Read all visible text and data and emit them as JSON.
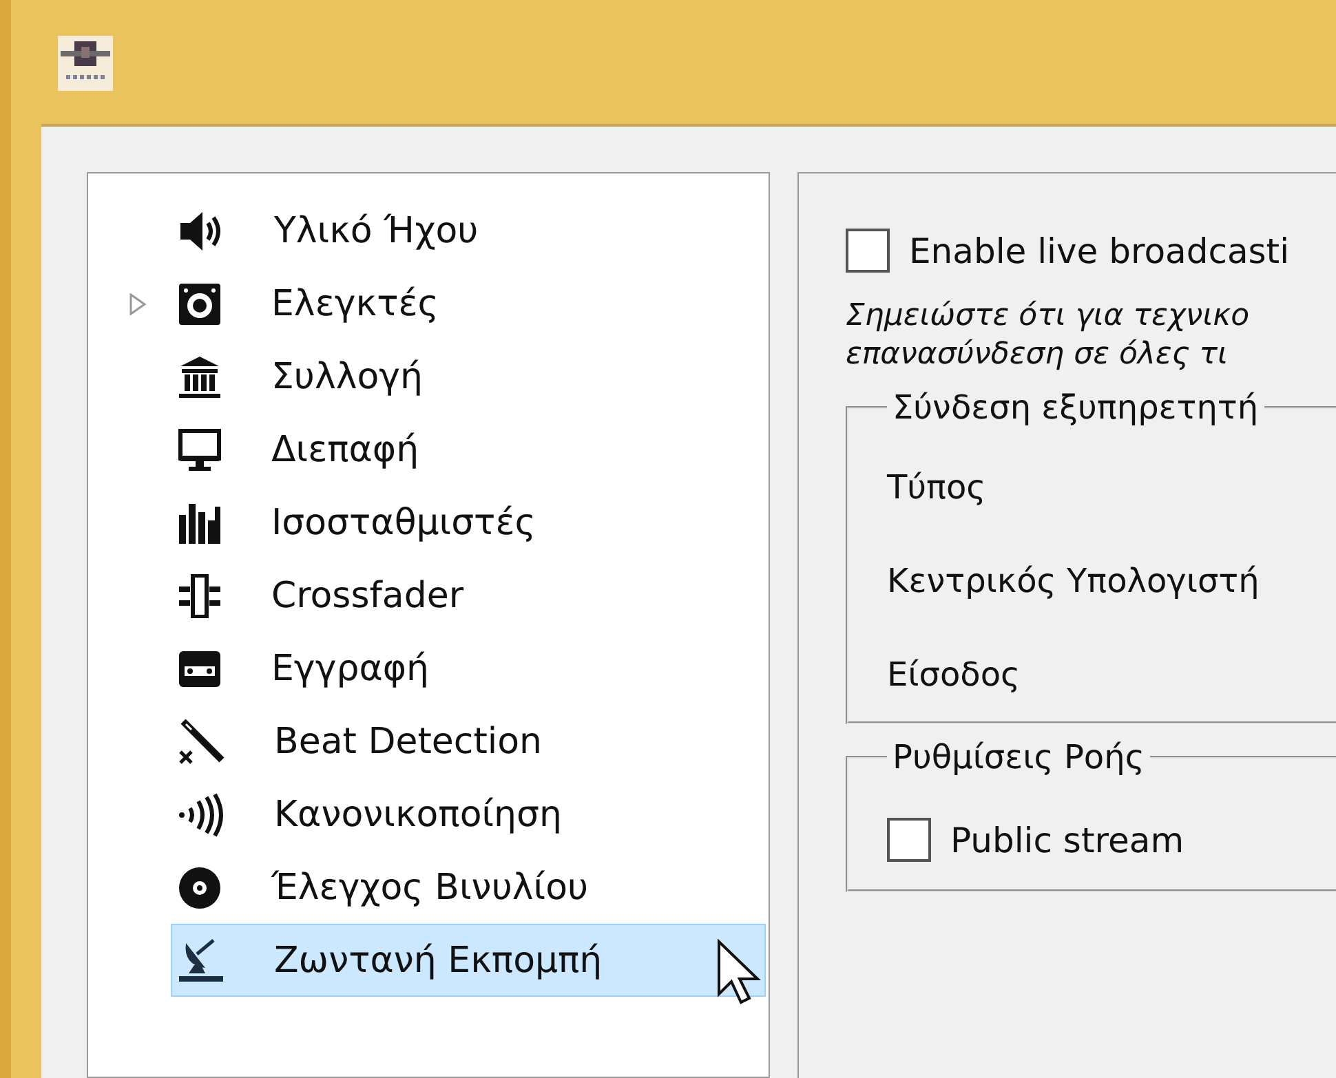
{
  "sidebar": {
    "items": [
      {
        "label": "Υλικό Ήχου",
        "selected": false
      },
      {
        "label": "Ελεγκτές",
        "selected": false,
        "expanded": false
      },
      {
        "label": "Συλλογή",
        "selected": false
      },
      {
        "label": "Διεπαφή",
        "selected": false
      },
      {
        "label": "Ισοσταθμιστές",
        "selected": false
      },
      {
        "label": "Crossfader",
        "selected": false
      },
      {
        "label": "Εγγραφή",
        "selected": false
      },
      {
        "label": "Beat Detection",
        "selected": false
      },
      {
        "label": "Κανονικοποίηση",
        "selected": false
      },
      {
        "label": "Έλεγχος Βινυλίου",
        "selected": false
      },
      {
        "label": "Ζωντανή Εκπομπή",
        "selected": true
      }
    ]
  },
  "broadcast": {
    "enable": {
      "label": "Enable live broadcasti",
      "checked": false
    },
    "note": [
      "Σημειώστε ότι για τεχνικο",
      "επανασύνδεση σε όλες τι"
    ],
    "groups": [
      {
        "title": "Σύνδεση εξυπηρετητή",
        "fields": [
          {
            "kind": "label",
            "label": "Τύπος"
          },
          {
            "kind": "label",
            "label": "Κεντρικός Υπολογιστή"
          },
          {
            "kind": "label",
            "label": "Είσοδος"
          }
        ]
      },
      {
        "title": "Ρυθμίσεις Ροής",
        "fields": [
          {
            "kind": "checkbox",
            "label": "Public stream",
            "checked": false
          }
        ]
      }
    ]
  }
}
